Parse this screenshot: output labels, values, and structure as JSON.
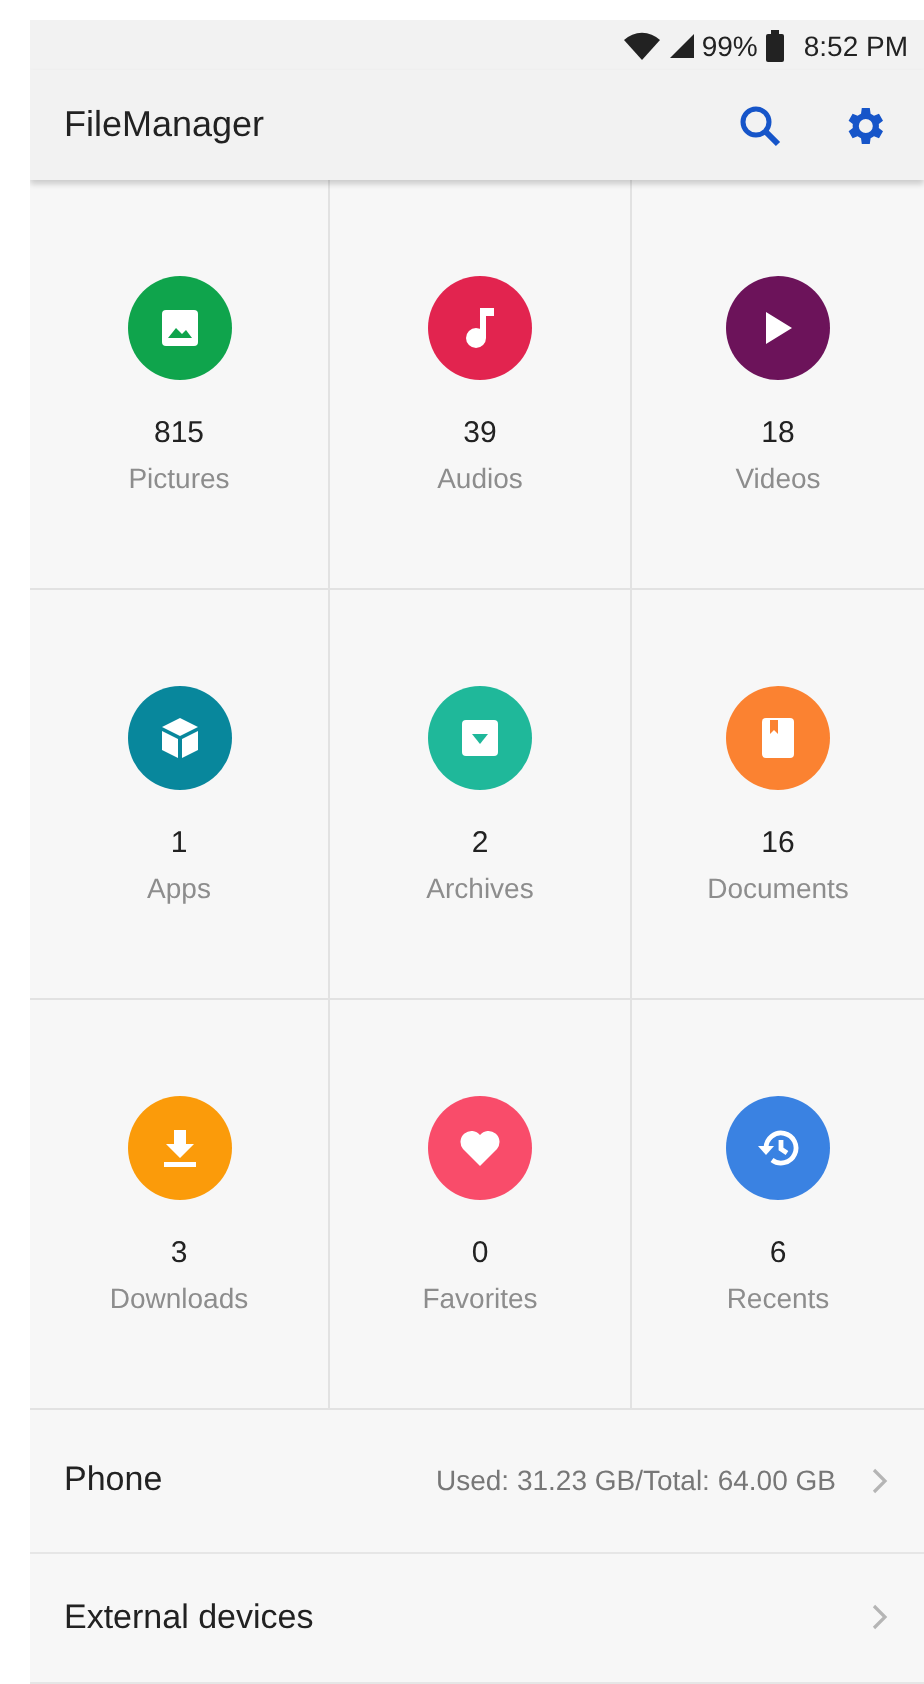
{
  "status_bar": {
    "battery_percent": "99%",
    "time": "8:52 PM"
  },
  "app_bar": {
    "title": "FileManager"
  },
  "categories": [
    {
      "kind": "pictures",
      "count": "815",
      "label": "Pictures",
      "color": "#0fa44c"
    },
    {
      "kind": "audios",
      "count": "39",
      "label": "Audios",
      "color": "#e2244f"
    },
    {
      "kind": "videos",
      "count": "18",
      "label": "Videos",
      "color": "#6c135a"
    },
    {
      "kind": "apps",
      "count": "1",
      "label": "Apps",
      "color": "#08879c"
    },
    {
      "kind": "archives",
      "count": "2",
      "label": "Archives",
      "color": "#1fb89a"
    },
    {
      "kind": "documents",
      "count": "16",
      "label": "Documents",
      "color": "#fb8231"
    },
    {
      "kind": "downloads",
      "count": "3",
      "label": "Downloads",
      "color": "#fb9b0a"
    },
    {
      "kind": "favorites",
      "count": "0",
      "label": "Favorites",
      "color": "#f94c6a"
    },
    {
      "kind": "recents",
      "count": "6",
      "label": "Recents",
      "color": "#3a82e2"
    }
  ],
  "storage": [
    {
      "name": "Phone",
      "detail": "Used: 31.23 GB/Total: 64.00 GB"
    },
    {
      "name": "External devices"
    }
  ]
}
